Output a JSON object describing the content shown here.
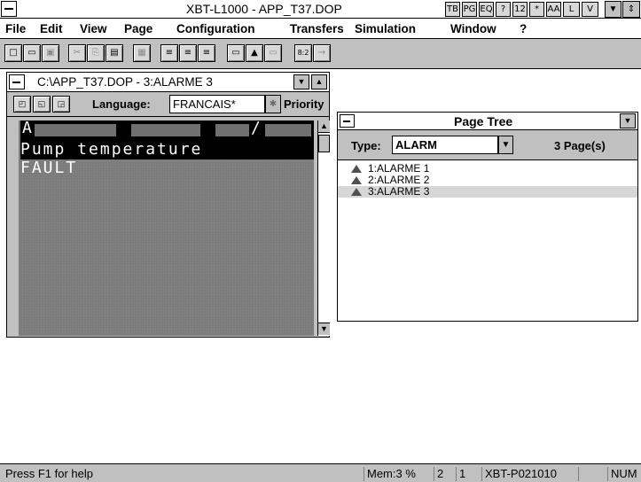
{
  "app": {
    "title": "XBT-L1000 - APP_T37.DOP"
  },
  "title_icons": [
    "TB",
    "PG",
    "EQ",
    "?",
    "12",
    "*",
    "AA",
    "L",
    "V"
  ],
  "window_buttons": {
    "minimize": "▼",
    "restore": "⇕"
  },
  "menu": [
    "File",
    "Edit",
    "View",
    "Page",
    "Configuration",
    "Transfers",
    "Simulation",
    "Window",
    "?"
  ],
  "toolbar": {
    "buttons": [
      {
        "name": "new",
        "glyph": "□"
      },
      {
        "name": "open",
        "glyph": "▭"
      },
      {
        "name": "save",
        "glyph": "▣"
      },
      {
        "name": "cut",
        "glyph": "✂"
      },
      {
        "name": "copy",
        "glyph": "⎘"
      },
      {
        "name": "paste",
        "glyph": "▤"
      },
      {
        "name": "delete",
        "glyph": "▦"
      },
      {
        "name": "align-left",
        "glyph": "≡"
      },
      {
        "name": "align-center",
        "glyph": "≡"
      },
      {
        "name": "align-right",
        "glyph": "≡"
      },
      {
        "name": "field",
        "glyph": "▭"
      },
      {
        "name": "alarm",
        "glyph": "▲"
      },
      {
        "name": "page",
        "glyph": "▭"
      },
      {
        "name": "number",
        "glyph": "8:2"
      },
      {
        "name": "link",
        "glyph": "→"
      }
    ]
  },
  "editor": {
    "path": "C:\\APP_T37.DOP - 3:ALARME 3",
    "language_label": "Language:",
    "language_value": "FRANCAIS*",
    "priority_label": "Priority",
    "lcd": {
      "line1_char": "A",
      "line1_slash": "/",
      "line2": "Pump temperature",
      "line3": "FAULT"
    }
  },
  "page_tree": {
    "title": "Page Tree",
    "type_label": "Type:",
    "type_value": "ALARM",
    "page_count": "3 Page(s)",
    "pages": [
      {
        "label": "1:ALARME 1",
        "selected": false
      },
      {
        "label": "2:ALARME 2",
        "selected": false
      },
      {
        "label": "3:ALARME 3",
        "selected": true
      }
    ]
  },
  "status": {
    "help": "Press F1 for help",
    "mem": "Mem:3 %",
    "a": "2",
    "b": "1",
    "terminal": "XBT-P021010",
    "num": "NUM"
  }
}
